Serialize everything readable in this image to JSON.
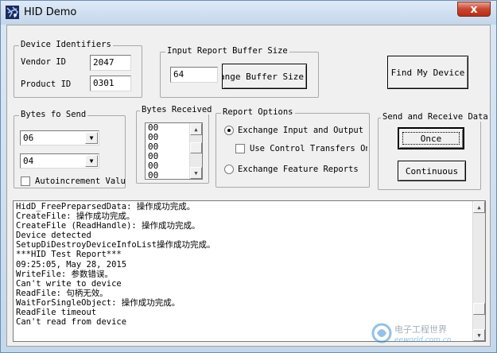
{
  "window": {
    "title": "HID Demo",
    "close_glyph": "x"
  },
  "device_identifiers": {
    "label": "Device Identifiers",
    "vendor_label": "Vendor ID",
    "vendor_value": "2047",
    "product_label": "Product ID",
    "product_value": "0301"
  },
  "input_report": {
    "label": "Input Report Buffer Size",
    "value": "64",
    "change_button": "Change Buffer Size"
  },
  "find_button": "Find My Device",
  "bytes_to_send": {
    "label": "Bytes fo Send",
    "combo1": "06",
    "combo2": "04",
    "autoincrement_label": "Autoincrement Values",
    "autoincrement_checked": false
  },
  "bytes_received": {
    "label": "Bytes Received",
    "items": [
      "00",
      "00",
      "00",
      "00",
      "00",
      "00"
    ]
  },
  "report_options": {
    "label": "Report Options",
    "option_exchange_io": "Exchange Input and Output Reports",
    "option_control_transfers": "Use Control Transfers Only",
    "option_feature": "Exchange Feature Reports",
    "selected": "exchange_io"
  },
  "send_receive": {
    "label": "Send and Receive Data",
    "once_button": "Once",
    "continuous_button": "Continuous"
  },
  "log": {
    "lines": [
      "HidD_FreePreparsedData: 操作成功完成。",
      "CreateFile: 操作成功完成。",
      "CreateFile (ReadHandle): 操作成功完成。",
      "Device detected",
      "SetupDiDestroyDeviceInfoList操作成功完成。",
      "***HID Test Report***",
      "09:25:05, May 28, 2015",
      "WriteFile: 参数错误。",
      "Can't write to device",
      "ReadFile: 句柄无效。",
      "WaitForSingleObject: 操作成功完成。",
      "ReadFile timeout",
      "Can't read from device"
    ]
  },
  "watermark": {
    "text_cn": "电子工程世界",
    "text_en": "eeworld.com.cn"
  },
  "colors": {
    "close_button": "#c9452d",
    "titlebar": "#c3d6ea",
    "client_bg": "#f0f0f0"
  }
}
